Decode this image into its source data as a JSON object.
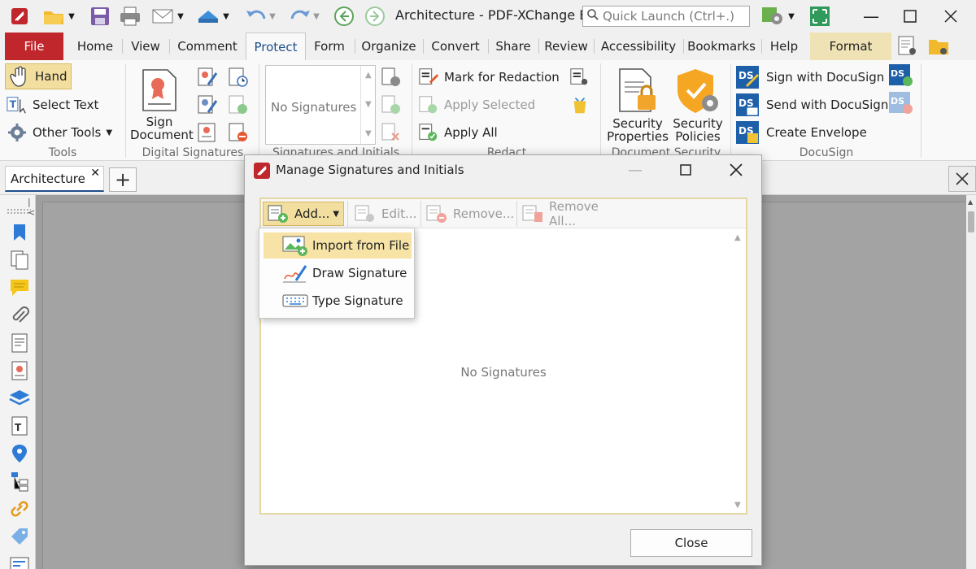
{
  "app": {
    "title": "Architecture - PDF-XChange E...",
    "quick_launch_placeholder": "Quick Launch (Ctrl+.)"
  },
  "menu": {
    "file": "File",
    "tabs": [
      "Home",
      "View",
      "Comment",
      "Protect",
      "Form",
      "Organize",
      "Convert",
      "Share",
      "Review",
      "Accessibility",
      "Bookmarks",
      "Help"
    ],
    "format": "Format",
    "active": "Protect"
  },
  "ribbon": {
    "tools": {
      "hand": "Hand",
      "select_text": "Select Text",
      "other_tools": "Other Tools",
      "label": "Tools"
    },
    "digital_signatures": {
      "sign_document_1": "Sign",
      "sign_document_2": "Document",
      "label": "Digital Signatures"
    },
    "signatures_initials": {
      "list_placeholder": "No Signatures",
      "label": "Signatures and Initials"
    },
    "redact": {
      "mark": "Mark for Redaction",
      "apply_selected": "Apply Selected",
      "apply_all": "Apply All",
      "label": "Redact"
    },
    "document_security": {
      "security_properties_1": "Security",
      "security_properties_2": "Properties",
      "security_policies_1": "Security",
      "security_policies_2": "Policies",
      "label": "Document Security"
    },
    "docusign": {
      "sign": "Sign with DocuSign",
      "send": "Send with DocuSign",
      "create": "Create Envelope",
      "label": "DocuSign"
    }
  },
  "document": {
    "tab_name": "Architecture"
  },
  "dialog": {
    "title": "Manage Signatures and Initials",
    "toolbar": {
      "add": "Add...",
      "edit": "Edit...",
      "remove": "Remove...",
      "remove_all": "Remove All..."
    },
    "empty_message": "No Signatures",
    "close": "Close"
  },
  "add_menu": {
    "items": [
      "Import from File",
      "Draw Signature",
      "Type Signature"
    ],
    "highlighted": "Import from File"
  },
  "colors": {
    "file_tab": "#c0272d",
    "highlight": "#f2dfa0",
    "accent": "#1f4e8a"
  }
}
